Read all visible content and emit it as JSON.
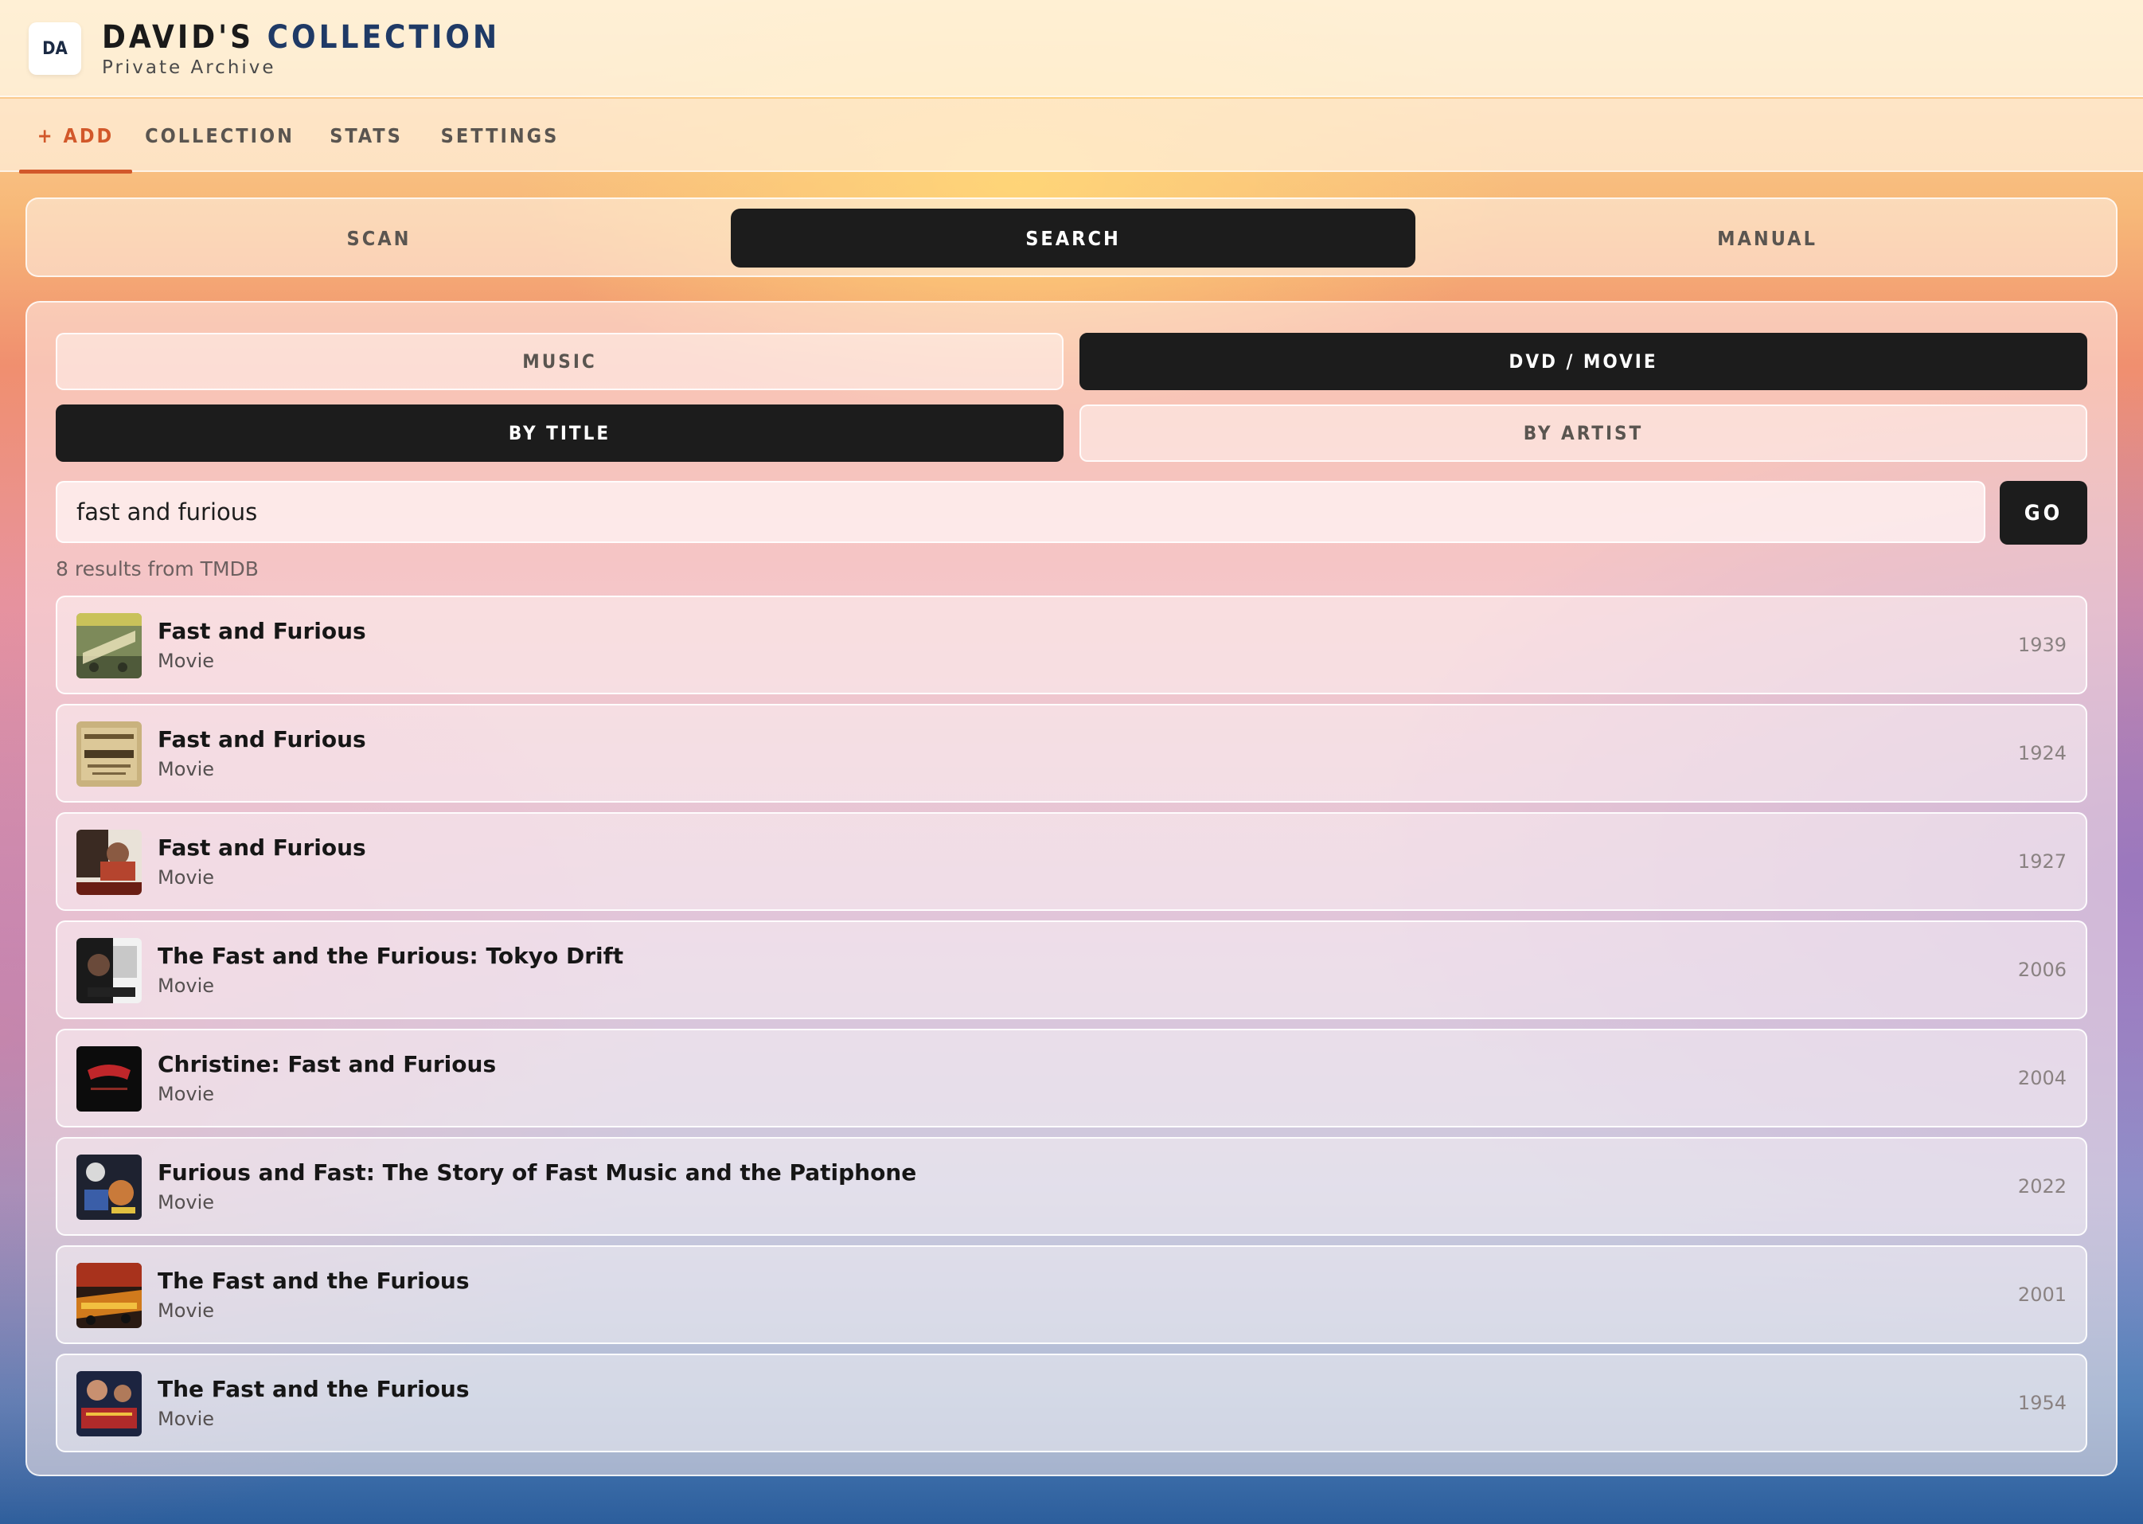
{
  "app": {
    "logo_initials": "DA",
    "title_part1": "DAVID'S",
    "title_part2": "COLLECTION",
    "subtitle": "Private Archive"
  },
  "nav": {
    "tabs": [
      {
        "label": "+ ADD",
        "active": true
      },
      {
        "label": "COLLECTION",
        "active": false
      },
      {
        "label": "STATS",
        "active": false
      },
      {
        "label": "SETTINGS",
        "active": false
      }
    ]
  },
  "mode": {
    "options": [
      {
        "label": "SCAN",
        "active": false
      },
      {
        "label": "SEARCH",
        "active": true
      },
      {
        "label": "MANUAL",
        "active": false
      }
    ]
  },
  "search": {
    "media_types": [
      {
        "label": "MUSIC",
        "active": false
      },
      {
        "label": "DVD / MOVIE",
        "active": true
      }
    ],
    "search_by": [
      {
        "label": "BY TITLE",
        "active": true
      },
      {
        "label": "BY ARTIST",
        "active": false
      }
    ],
    "query": "fast and furious",
    "go_label": "GO",
    "results_count": "8 results from TMDB"
  },
  "results": [
    {
      "title": "Fast and Furious",
      "type": "Movie",
      "year": "1939",
      "poster": "fast-and-furious-1939-poster"
    },
    {
      "title": "Fast and Furious",
      "type": "Movie",
      "year": "1924",
      "poster": "fast-and-furious-1924-poster"
    },
    {
      "title": "Fast and Furious",
      "type": "Movie",
      "year": "1927",
      "poster": "fast-and-furious-1927-poster"
    },
    {
      "title": "The Fast and the Furious: Tokyo Drift",
      "type": "Movie",
      "year": "2006",
      "poster": "tokyo-drift-poster"
    },
    {
      "title": "Christine: Fast and Furious",
      "type": "Movie",
      "year": "2004",
      "poster": "christine-poster"
    },
    {
      "title": "Furious and Fast: The Story of Fast Music and the Patiphone",
      "type": "Movie",
      "year": "2022",
      "poster": "patiphone-poster"
    },
    {
      "title": "The Fast and the Furious",
      "type": "Movie",
      "year": "2001",
      "poster": "fast-and-furious-2001-poster"
    },
    {
      "title": "The Fast and the Furious",
      "type": "Movie",
      "year": "1954",
      "poster": "fast-and-furious-1954-poster"
    }
  ],
  "colors": {
    "accent": "#d2582a",
    "brand_accent": "#1f3a66",
    "active_button": "#1c1c1c"
  }
}
